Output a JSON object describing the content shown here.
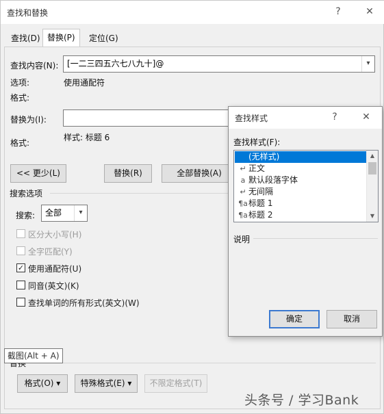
{
  "window": {
    "title": "查找和替换",
    "help": "?",
    "close": "✕"
  },
  "tabs": [
    {
      "label": "查找(D)",
      "active": false
    },
    {
      "label": "替换(P)",
      "active": true
    },
    {
      "label": "定位(G)",
      "active": false
    }
  ],
  "find": {
    "label": "查找内容(N):",
    "value": "[一二三四五六七八九十]@",
    "options_label": "选项:",
    "options_value": "使用通配符",
    "format_label": "格式:"
  },
  "replace": {
    "label": "替换为(I):",
    "value": "",
    "format_label": "格式:",
    "format_value": "样式: 标题 6"
  },
  "buttons": {
    "less": "<< 更少(L)",
    "replace": "替换(R)",
    "replace_all": "全部替换(A)"
  },
  "search_options": {
    "heading": "搜索选项",
    "search_label": "搜索:",
    "search_value": "全部",
    "checkboxes": [
      {
        "label": "区分大小写(H)",
        "checked": false,
        "disabled": true
      },
      {
        "label": "全字匹配(Y)",
        "checked": false,
        "disabled": true
      },
      {
        "label": "使用通配符(U)",
        "checked": true,
        "disabled": false
      },
      {
        "label": "同音(英文)(K)",
        "checked": false,
        "disabled": false
      },
      {
        "label": "查找单词的所有形式(英文)(W)",
        "checked": false,
        "disabled": false
      }
    ]
  },
  "replace_section": {
    "heading": "替换",
    "format_button": "格式(O) ▾",
    "special_button": "特殊格式(E) ▾",
    "no_format_button": "不限定格式(T)"
  },
  "tooltip": "截图(Alt + A)",
  "style_dialog": {
    "title": "查找样式",
    "help": "?",
    "close": "✕",
    "list_label": "查找样式(F):",
    "items": [
      {
        "glyph": "",
        "label": "(无样式)",
        "selected": true
      },
      {
        "glyph": "↵",
        "label": "正文",
        "selected": false
      },
      {
        "glyph": "a",
        "label": "默认段落字体",
        "selected": false
      },
      {
        "glyph": "↵",
        "label": "无间隔",
        "selected": false
      },
      {
        "glyph": "¶a",
        "label": "标题 1",
        "selected": false
      },
      {
        "glyph": "¶a",
        "label": "标题 2",
        "selected": false
      }
    ],
    "description_label": "说明",
    "ok": "确定",
    "cancel": "取消"
  },
  "watermark": "头条号 / 学习Bank"
}
